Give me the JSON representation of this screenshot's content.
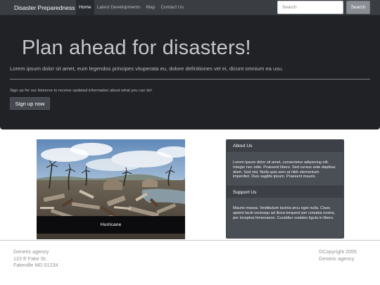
{
  "navbar": {
    "brand": "Disaster Preparedness",
    "links": [
      {
        "label": "Home",
        "active": true
      },
      {
        "label": "Latest Developments",
        "active": false
      },
      {
        "label": "Map",
        "active": false
      },
      {
        "label": "Contact Us",
        "active": false
      }
    ],
    "search": {
      "placeholder": "Search",
      "value": ""
    },
    "search_button": "Search"
  },
  "hero": {
    "title": "Plan ahead for disasters!",
    "lead": "Lorem ipsum dolor sit amet, eum legendos principes vituperata eu, dolore definitiones vel ei, dicunt omnium ea usu.",
    "note": "Sign up for our listserve to receive updated information about what you can do!",
    "button": "Sign up now"
  },
  "photo": {
    "caption": "Hurricane",
    "icon": "hurricane-damage-photo"
  },
  "sidebar": {
    "sections": [
      {
        "heading": "About Us",
        "body": "Lorem ipsum dolor sit amet, consectetur adipiscing elit. Integer nec odio. Praesent libero. Sed cursus ante dapibus diam. Sed nisi. Nulla quis sem at nibh elementum imperdiet. Duis sagittis ipsum. Praesent mauris."
      },
      {
        "heading": "Support Us",
        "body": "Mauris massa. Vestibulum lacinia arcu eget nulla. Class aptent taciti sociosqu ad litora torquent per conubia nostra, per inceptos himenaeos. Curabitur sodales ligula in libero."
      }
    ]
  },
  "footer": {
    "address_lines": [
      "Generic agency",
      "123 E Fake St.",
      "Fakeville MD 01234"
    ],
    "right_lines": [
      "©Copyright 2055",
      "Generic agency"
    ]
  },
  "colors": {
    "navbar": "#3a3d42",
    "hero_background": "#202226",
    "panel": "#4a4e55",
    "footer_text": "#8d9094"
  }
}
